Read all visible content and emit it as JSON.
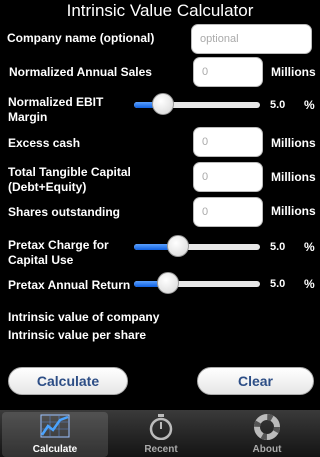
{
  "app": {
    "title": "Intrinsic Value Calculator"
  },
  "form": {
    "company_name": {
      "label": "Company name (optional)",
      "placeholder": "optional"
    },
    "sales": {
      "label": "Normalized Annual Sales",
      "placeholder": "0",
      "unit": "Millions"
    },
    "ebit_margin": {
      "label_line1": "Normalized EBIT",
      "label_line2": "Margin",
      "value_text": "5.0",
      "unit": "%",
      "slider_fraction": 0.17
    },
    "excess_cash": {
      "label": "Excess cash",
      "placeholder": "0",
      "unit": "Millions"
    },
    "tangible_capital": {
      "label_line1": "Total Tangible Capital",
      "label_line2": "(Debt+Equity)",
      "placeholder": "0",
      "unit": "Millions"
    },
    "shares": {
      "label": "Shares outstanding",
      "placeholder": "0",
      "unit": "Millions"
    },
    "pretax_charge": {
      "label_line1": "Pretax Charge for",
      "label_line2": "Capital Use",
      "value_text": "5.0",
      "unit": "%",
      "slider_fraction": 0.32
    },
    "pretax_return": {
      "label": "Pretax Annual Return",
      "value_text": "5.0",
      "unit": "%",
      "slider_fraction": 0.22
    }
  },
  "results": {
    "company_label": "Intrinsic value of company",
    "share_label": "Intrinsic value per share"
  },
  "buttons": {
    "calculate": "Calculate",
    "clear": "Clear"
  },
  "tabs": [
    {
      "label": "Calculate",
      "icon": "chart-icon",
      "active": true
    },
    {
      "label": "Recent",
      "icon": "stopwatch-icon",
      "active": false
    },
    {
      "label": "About",
      "icon": "lifebuoy-icon",
      "active": false
    }
  ],
  "colors": {
    "accent": "#2d4e86",
    "slider_fill": "#1f6fe8"
  }
}
